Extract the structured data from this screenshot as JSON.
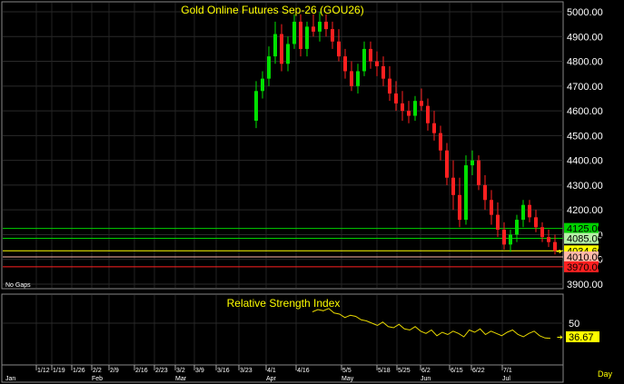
{
  "chart_data": [
    {
      "type": "candlestick",
      "title": "Gold Online Futures Sep-26 (GOU26)",
      "note": "No Gaps",
      "ylim": [
        3900,
        5000
      ],
      "y_ticks": [
        "5000.00",
        "4900.00",
        "4800.00",
        "4700.00",
        "4600.00",
        "4500.00",
        "4400.00",
        "4300.00",
        "4200.00",
        "4100.00",
        "4000.00",
        "3900.00"
      ],
      "x_ticks_week": [
        "1/12",
        "1/19",
        "1/26",
        "2/2",
        "2/9",
        "2/16",
        "2/23",
        "3/2",
        "3/9",
        "3/16",
        "3/23",
        "4/1",
        "4/16",
        "5/5",
        "5/18",
        "5/25",
        "6/2",
        "6/15",
        "6/22",
        "7/1"
      ],
      "x_ticks_month": [
        "Jan",
        "Feb",
        "Mar",
        "Apr",
        "May",
        "Jun",
        "Jul"
      ],
      "x_axis_end_label": "Day",
      "horizontal_lines": [
        {
          "value": 4125.0,
          "label": "4125.00",
          "color": "#00d000",
          "label_bg": "#00d000",
          "label_color": "#000000"
        },
        {
          "value": 4085.0,
          "label": "4085.00",
          "color": "#00d000",
          "label_bg": "#b6f0a8",
          "label_color": "#000000"
        },
        {
          "value": 4034.6,
          "label": "4034.60",
          "color": "#ffff00",
          "label_bg": "#ffff00",
          "label_color": "#000000"
        },
        {
          "value": 4010.0,
          "label": "4010.00",
          "color": "#ffb8a8",
          "label_bg": "#ffb8a8",
          "label_color": "#000000"
        },
        {
          "value": 3970.0,
          "label": "3970.00",
          "color": "#ff2020",
          "label_bg": "#ff2020",
          "label_color": "#000000"
        }
      ],
      "candles": [
        [
          4560,
          4720,
          4530,
          4680
        ],
        [
          4680,
          4760,
          4650,
          4730
        ],
        [
          4730,
          4860,
          4700,
          4820
        ],
        [
          4820,
          4960,
          4790,
          4910
        ],
        [
          4910,
          4950,
          4760,
          4790
        ],
        [
          4790,
          4900,
          4760,
          4870
        ],
        [
          4870,
          4990,
          4850,
          4960
        ],
        [
          4960,
          4990,
          4820,
          4850
        ],
        [
          4850,
          4960,
          4820,
          4940
        ],
        [
          4940,
          4990,
          4900,
          4920
        ],
        [
          4920,
          5000,
          4880,
          4960
        ],
        [
          4960,
          4990,
          4900,
          4930
        ],
        [
          4930,
          4960,
          4850,
          4880
        ],
        [
          4880,
          4930,
          4800,
          4820
        ],
        [
          4820,
          4850,
          4730,
          4760
        ],
        [
          4760,
          4800,
          4680,
          4700
        ],
        [
          4700,
          4790,
          4670,
          4760
        ],
        [
          4760,
          4880,
          4740,
          4850
        ],
        [
          4850,
          4880,
          4770,
          4800
        ],
        [
          4800,
          4840,
          4740,
          4780
        ],
        [
          4780,
          4820,
          4700,
          4730
        ],
        [
          4730,
          4780,
          4640,
          4670
        ],
        [
          4670,
          4720,
          4600,
          4630
        ],
        [
          4630,
          4680,
          4560,
          4600
        ],
        [
          4600,
          4640,
          4550,
          4580
        ],
        [
          4580,
          4660,
          4560,
          4640
        ],
        [
          4640,
          4690,
          4600,
          4620
        ],
        [
          4620,
          4650,
          4520,
          4550
        ],
        [
          4550,
          4600,
          4480,
          4510
        ],
        [
          4510,
          4540,
          4400,
          4440
        ],
        [
          4440,
          4470,
          4300,
          4330
        ],
        [
          4330,
          4400,
          4200,
          4260
        ],
        [
          4260,
          4330,
          4130,
          4160
        ],
        [
          4160,
          4420,
          4140,
          4380
        ],
        [
          4380,
          4440,
          4340,
          4400
        ],
        [
          4400,
          4420,
          4280,
          4300
        ],
        [
          4300,
          4340,
          4200,
          4240
        ],
        [
          4240,
          4280,
          4140,
          4180
        ],
        [
          4180,
          4230,
          4090,
          4120
        ],
        [
          4120,
          4150,
          4040,
          4060
        ],
        [
          4060,
          4120,
          4030,
          4100
        ],
        [
          4100,
          4180,
          4070,
          4160
        ],
        [
          4160,
          4240,
          4130,
          4220
        ],
        [
          4220,
          4240,
          4150,
          4170
        ],
        [
          4170,
          4200,
          4110,
          4130
        ],
        [
          4130,
          4150,
          4070,
          4090
        ],
        [
          4090,
          4120,
          4050,
          4070
        ],
        [
          4070,
          4100,
          4020,
          4034.6
        ]
      ]
    },
    {
      "type": "line",
      "title": "Relative Strength Index",
      "y_ticks": [
        "50"
      ],
      "last_value_label": "36.67",
      "values": [
        60,
        62,
        61,
        63,
        59,
        58,
        55,
        57,
        56,
        53,
        52,
        50,
        48,
        51,
        47,
        46,
        49,
        45,
        44,
        47,
        43,
        41,
        44,
        39,
        42,
        40,
        43,
        41,
        38,
        44,
        42,
        45,
        40,
        43,
        41,
        39,
        42,
        44,
        40,
        38,
        41,
        43,
        39,
        37,
        36.67
      ]
    }
  ]
}
